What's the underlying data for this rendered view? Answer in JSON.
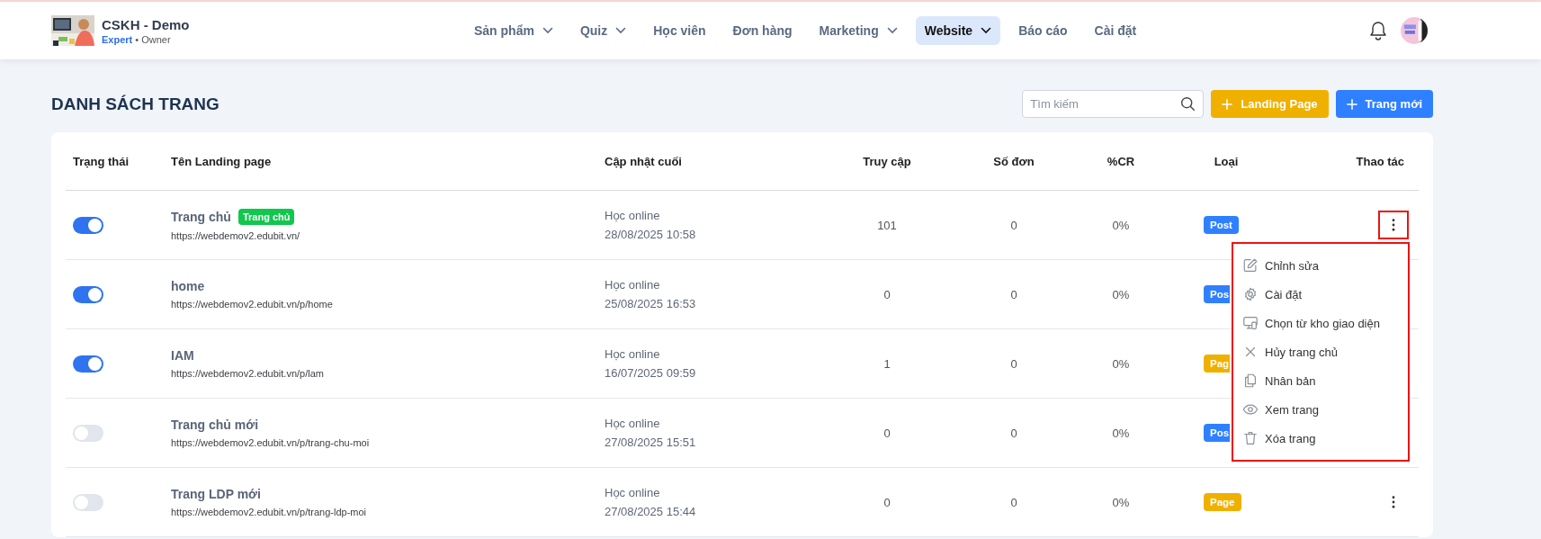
{
  "brand": {
    "name": "CSKH - Demo",
    "plan": "Expert",
    "role": "• Owner"
  },
  "nav": [
    {
      "label": "Sản phẩm",
      "dropdown": true,
      "selected": false
    },
    {
      "label": "Quiz",
      "dropdown": true,
      "selected": false
    },
    {
      "label": "Học viên",
      "dropdown": false,
      "selected": false
    },
    {
      "label": "Đơn hàng",
      "dropdown": false,
      "selected": false
    },
    {
      "label": "Marketing",
      "dropdown": true,
      "selected": false
    },
    {
      "label": "Website",
      "dropdown": true,
      "selected": true
    },
    {
      "label": "Báo cáo",
      "dropdown": false,
      "selected": false
    },
    {
      "label": "Cài đặt",
      "dropdown": false,
      "selected": false
    }
  ],
  "page_title": "DANH SÁCH TRANG",
  "search": {
    "placeholder": "Tìm kiếm"
  },
  "buttons": [
    {
      "label": "Landing Page",
      "kind": "landing"
    },
    {
      "label": "Trang mới",
      "kind": "new"
    }
  ],
  "table": {
    "columns": [
      "Trạng thái",
      "Tên Landing page",
      "Cập nhật cuối",
      "Truy cập",
      "Số đơn",
      "%CR",
      "Loại",
      "Thao tác"
    ],
    "rows": [
      {
        "enabled": true,
        "name": "Trang chủ",
        "tag": "Trang chủ",
        "url": "https://webdemov2.edubit.vn/",
        "source": "Học online",
        "updated": "28/08/2025 10:58",
        "visits": "101",
        "orders": "0",
        "cr": "0%",
        "type": "Post",
        "color": "#2f80ff",
        "covered": false,
        "menu_open": true
      },
      {
        "enabled": true,
        "name": "home",
        "url": "https://webdemov2.edubit.vn/p/home",
        "source": "Học online",
        "updated": "25/08/2025 16:53",
        "visits": "0",
        "orders": "0",
        "cr": "0%",
        "type": "Pos",
        "color": "#2f80ff",
        "covered": true,
        "menu_open": false
      },
      {
        "enabled": true,
        "name": "IAM",
        "url": "https://webdemov2.edubit.vn/p/lam",
        "source": "Học online",
        "updated": "16/07/2025 09:59",
        "visits": "1",
        "orders": "0",
        "cr": "0%",
        "type": "Pag",
        "color": "#f0b000",
        "covered": true,
        "menu_open": false
      },
      {
        "enabled": false,
        "name": "Trang chủ mới",
        "url": "https://webdemov2.edubit.vn/p/trang-chu-moi",
        "source": "Học online",
        "updated": "27/08/2025 15:51",
        "visits": "0",
        "orders": "0",
        "cr": "0%",
        "type": "Pos",
        "color": "#2f80ff",
        "covered": true,
        "menu_open": false
      },
      {
        "enabled": false,
        "name": "Trang LDP mới",
        "url": "https://webdemov2.edubit.vn/p/trang-ldp-moi",
        "source": "Học online",
        "updated": "27/08/2025 15:44",
        "visits": "0",
        "orders": "0",
        "cr": "0%",
        "type": "Page",
        "color": "#f0b000",
        "covered": false,
        "menu_open": false
      }
    ]
  },
  "action_menu": {
    "items": [
      {
        "label": "Chỉnh sửa",
        "kind": "edit"
      },
      {
        "label": "Cài đặt",
        "kind": "settings"
      },
      {
        "label": "Chọn từ kho giao diện",
        "kind": "template"
      },
      {
        "label": "Hủy trang chủ",
        "kind": "cancel"
      },
      {
        "label": "Nhân bản",
        "kind": "duplicate"
      },
      {
        "label": "Xem trang",
        "kind": "view"
      },
      {
        "label": "Xóa trang",
        "kind": "delete"
      }
    ]
  }
}
